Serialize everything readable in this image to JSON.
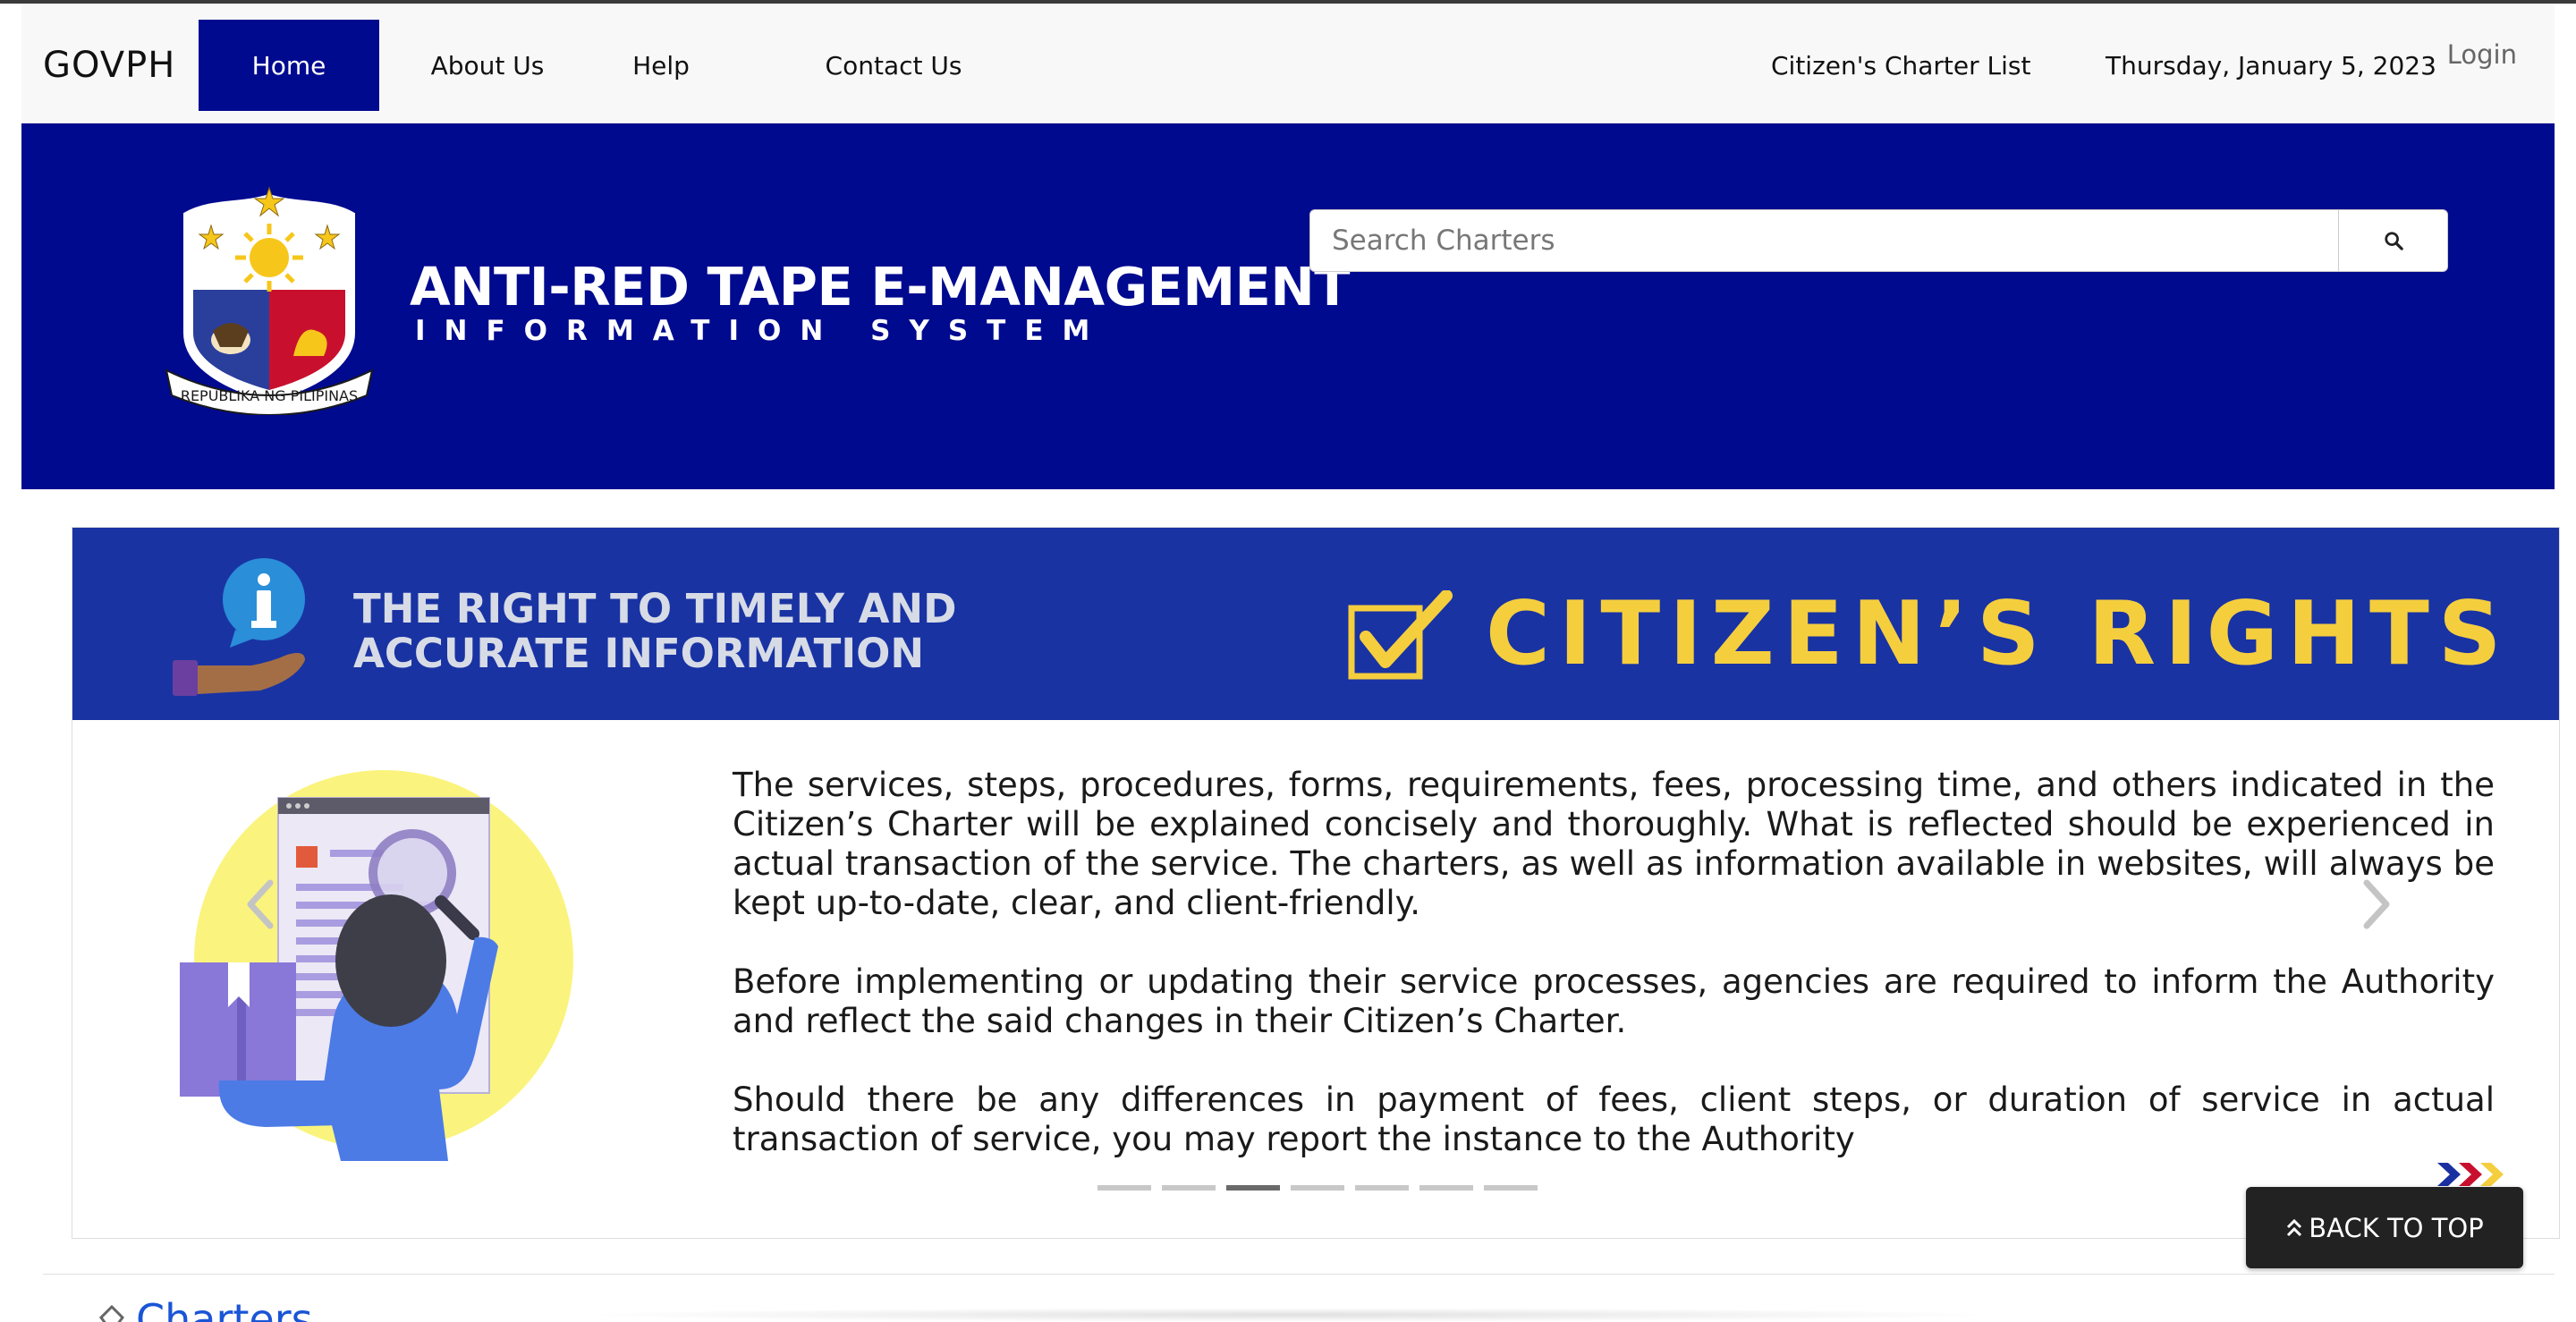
{
  "nav": {
    "brand": "GOVPH",
    "items": [
      {
        "label": "Home",
        "active": true
      },
      {
        "label": "About Us"
      },
      {
        "label": "Help"
      },
      {
        "label": "Contact Us"
      }
    ],
    "charter_list": "Citizen's Charter List",
    "date": "Thursday, January 5, 2023",
    "login": "Login"
  },
  "header": {
    "title": "ANTI-RED TAPE E-MANAGEMENT",
    "subtitle": "INFORMATION SYSTEM",
    "seal_text": "REPUBLIKA NG PILIPINAS",
    "search": {
      "placeholder": "Search Charters"
    }
  },
  "carousel": {
    "right_title": "THE RIGHT TO TIMELY AND\nACCURATE INFORMATION",
    "banner_label": "CITIZEN’S RIGHTS",
    "paragraphs": [
      "The services, steps, procedures, forms, requirements, fees, processing time, and others indicated in the Citizen’s Charter will be explained concisely and thoroughly. What is reflected should be experienced in actual transaction of the service. The charters, as well as information available in websites, will always be kept up-to-date, clear, and client-friendly.",
      "Before implementing or updating their service processes, agencies are required to inform the Authority and reflect the said changes in their Citizen’s Charter.",
      "Should there be any differences in payment of fees, client steps, or duration of service in actual transaction of service, you may report the instance to the Authority"
    ],
    "indicator_count": 7,
    "active_indicator": 3
  },
  "back_to_top": "BACK TO TOP",
  "section": {
    "heading": "Charters"
  },
  "colors": {
    "nav_active": "#000a8f",
    "header_bg": "#000a8f",
    "banner_bg": "#1933a3",
    "rights_yellow": "#f5ce3e",
    "link_blue": "#1a55d6"
  }
}
